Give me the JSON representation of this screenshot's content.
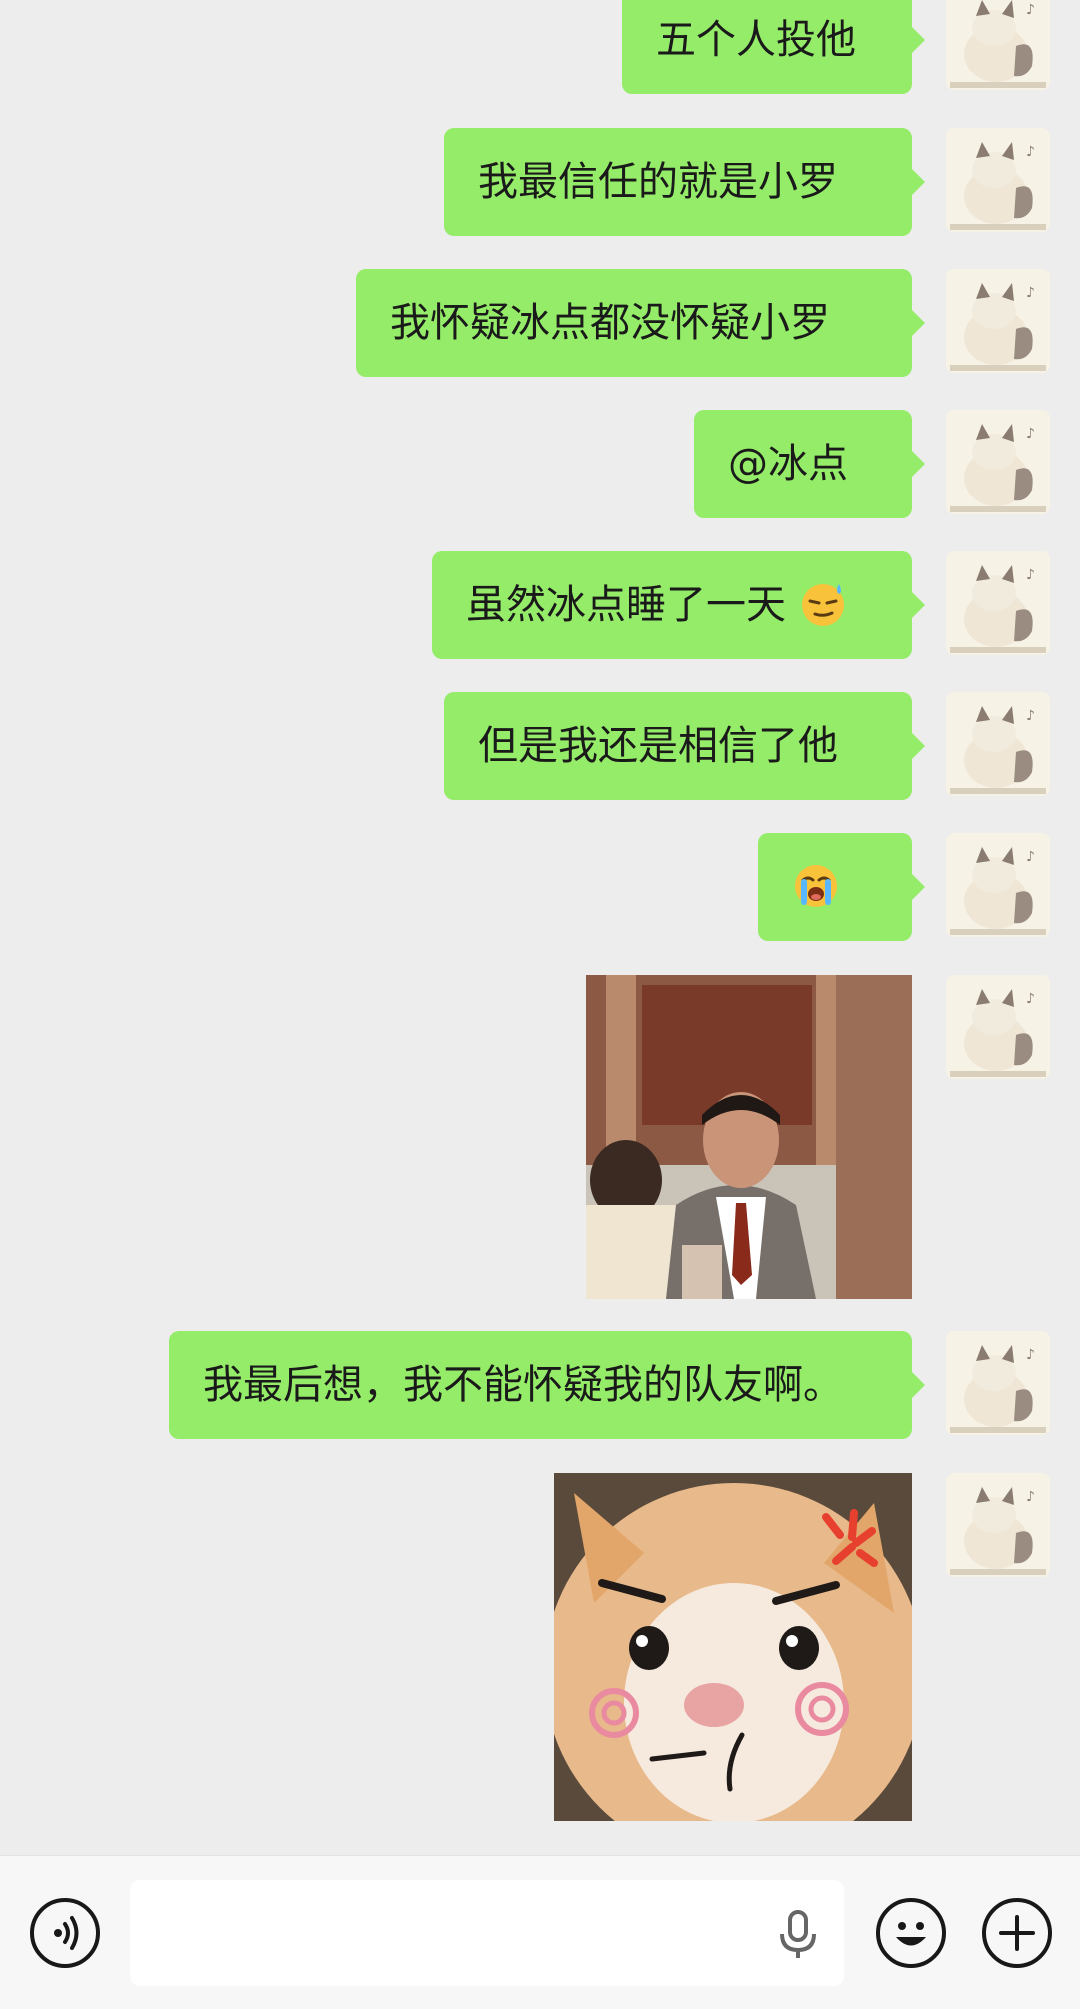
{
  "messages": [
    {
      "type": "text",
      "text": "五个人投他"
    },
    {
      "type": "text",
      "text": "我最信任的就是小罗"
    },
    {
      "type": "text",
      "text": "我怀疑冰点都没怀疑小罗"
    },
    {
      "type": "text",
      "text": "@冰点"
    },
    {
      "type": "text",
      "text": "虽然冰点睡了一天",
      "emoji": "sweat-smile-emoji"
    },
    {
      "type": "text",
      "text": "但是我还是相信了他"
    },
    {
      "type": "emoji-only",
      "emoji": "loudly-crying-face-emoji"
    },
    {
      "type": "image",
      "description": "man-in-suit-gif-sticker"
    },
    {
      "type": "text",
      "text": "我最后想，我不能怀疑我的队友啊。"
    },
    {
      "type": "image",
      "description": "angry-kitten-sticker"
    }
  ],
  "input_bar": {
    "voice_icon": "voice-icon",
    "mic_icon": "microphone-icon",
    "emoji_icon": "smiley-icon",
    "plus_icon": "plus-icon",
    "value": ""
  },
  "colors": {
    "chat_background": "#ededed",
    "bubble_green": "#95ec69",
    "input_bar_background": "#f7f7f7"
  }
}
